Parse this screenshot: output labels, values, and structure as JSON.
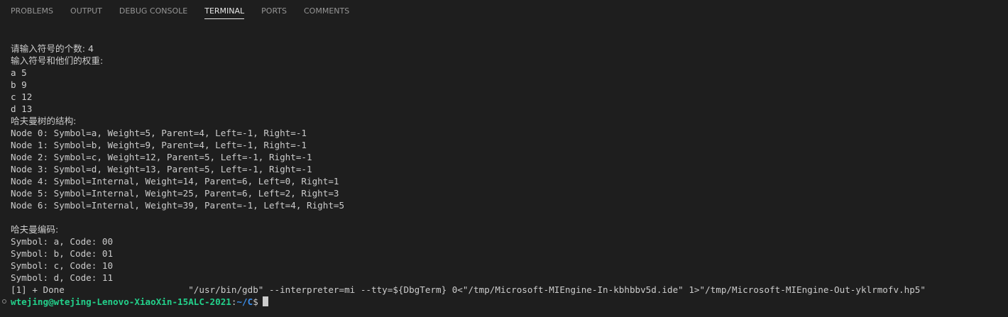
{
  "tabs": [
    {
      "label": "PROBLEMS"
    },
    {
      "label": "OUTPUT"
    },
    {
      "label": "DEBUG CONSOLE"
    },
    {
      "label": "TERMINAL"
    },
    {
      "label": "PORTS"
    },
    {
      "label": "COMMENTS"
    }
  ],
  "terminal": {
    "lines": [
      "请输入符号的个数: 4",
      "输入符号和他们的权重:",
      "a 5",
      "b 9",
      "c 12",
      "d 13",
      "哈夫曼树的结构:",
      "Node 0: Symbol=a, Weight=5, Parent=4, Left=-1, Right=-1",
      "Node 1: Symbol=b, Weight=9, Parent=4, Left=-1, Right=-1",
      "Node 2: Symbol=c, Weight=12, Parent=5, Left=-1, Right=-1",
      "Node 3: Symbol=d, Weight=13, Parent=5, Left=-1, Right=-1",
      "Node 4: Symbol=Internal, Weight=14, Parent=6, Left=0, Right=1",
      "Node 5: Symbol=Internal, Weight=25, Parent=6, Left=2, Right=3",
      "Node 6: Symbol=Internal, Weight=39, Parent=-1, Left=4, Right=5",
      "",
      "哈夫曼编码:",
      "Symbol: a, Code: 00",
      "Symbol: b, Code: 01",
      "Symbol: c, Code: 10",
      "Symbol: d, Code: 11",
      "[1] + Done                       \"/usr/bin/gdb\" --interpreter=mi --tty=${DbgTerm} 0<\"/tmp/Microsoft-MIEngine-In-kbhbbv5d.ide\" 1>\"/tmp/Microsoft-MIEngine-Out-yklrmofv.hp5\""
    ],
    "prompt": {
      "user": "wtejing@wtejing-Lenovo-XiaoXin-15ALC-2021",
      "colon": ":",
      "path": "~/C",
      "symbol": "$"
    }
  },
  "colors": {
    "background": "#1e1e1e",
    "text": "#cccccc",
    "prompt_user": "#23d18b",
    "prompt_path": "#3b8eea"
  }
}
